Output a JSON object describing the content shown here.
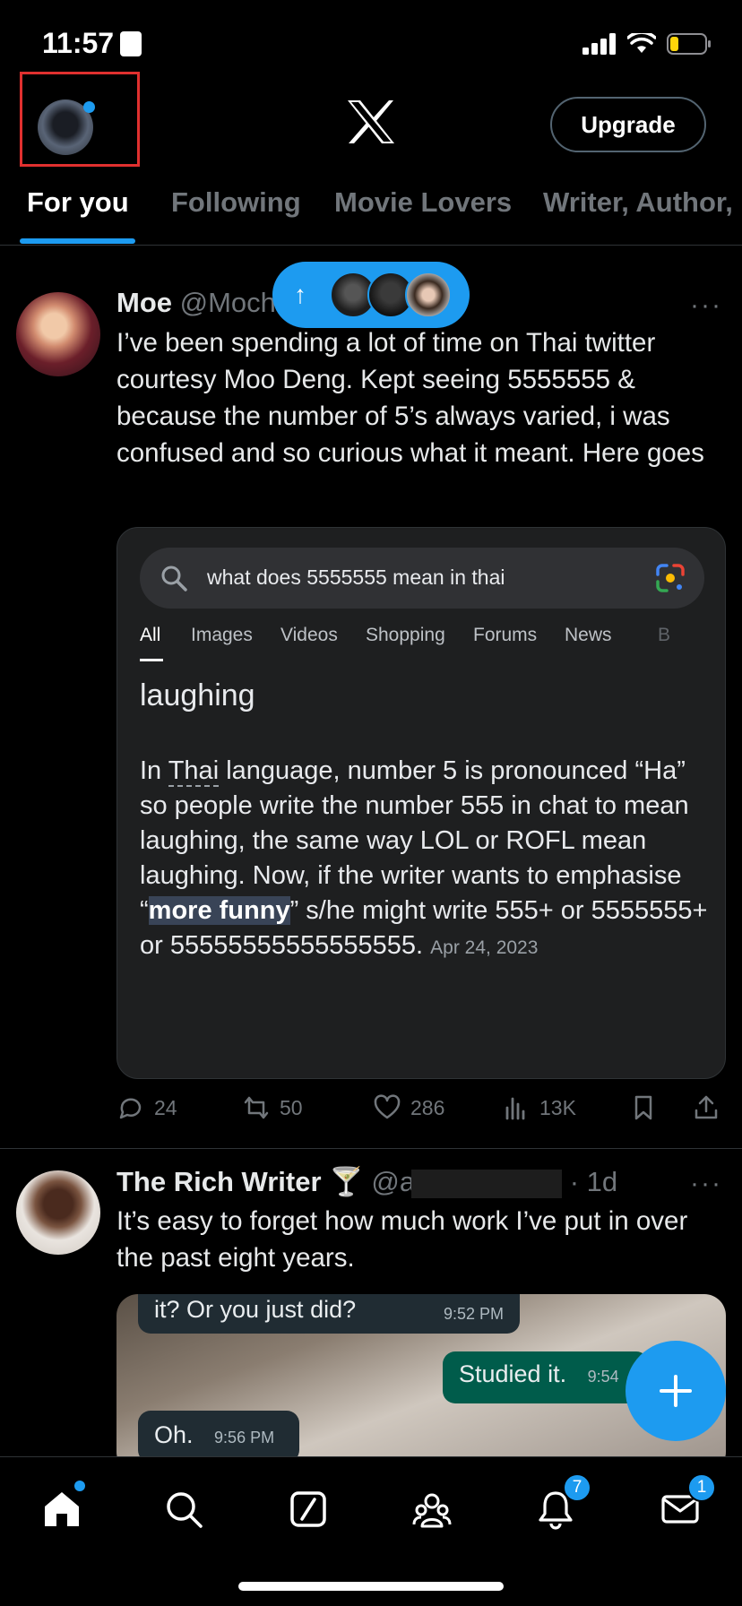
{
  "status": {
    "time": "11:57"
  },
  "header": {
    "upgrade_label": "Upgrade"
  },
  "tabs": [
    {
      "label": "For you",
      "active": true
    },
    {
      "label": "Following"
    },
    {
      "label": "Movie Lovers"
    },
    {
      "label": "Writer, Author,"
    }
  ],
  "tweet1": {
    "name": "Moe",
    "handle": "@Moch",
    "text": "I’ve been spending a lot of time on Thai twitter courtesy Moo Deng. Kept seeing 5555555 & because the number of 5’s always varied, i was confused and so curious what it meant. Here goes",
    "card": {
      "search_query": "what does 5555555 mean in thai",
      "tabs": [
        "All",
        "Images",
        "Videos",
        "Shopping",
        "Forums",
        "News",
        "B"
      ],
      "answer_title": "laughing",
      "body_before": "In ",
      "body_thai": "Thai",
      "body_mid": " language, number 5 is pronounced “Ha” so people write the number 555 in chat to mean laughing, the same way LOL or ROFL mean laughing. Now, if the writer wants to emphasise “",
      "body_highlight": "more funny",
      "body_after": "” s/he might write 555+ or 5555555+ or 55555555555555555.",
      "date": "Apr 24, 2023"
    },
    "stats": {
      "replies": "24",
      "reposts": "50",
      "likes": "286",
      "views": "13K"
    }
  },
  "tweet2": {
    "name": "The Rich Writer 🍸",
    "handle_prefix": "@a",
    "age": "· 1d",
    "text": "It’s easy to forget how much work I’ve put in over the past eight years.",
    "chat": [
      {
        "text": "it? Or you just did?",
        "time": "9:52 PM"
      },
      {
        "text": "Studied it.",
        "time": "9:54"
      },
      {
        "text": "Oh.",
        "time": "9:56 PM"
      }
    ]
  },
  "nav": {
    "notifications_badge": "7",
    "messages_badge": "1"
  }
}
